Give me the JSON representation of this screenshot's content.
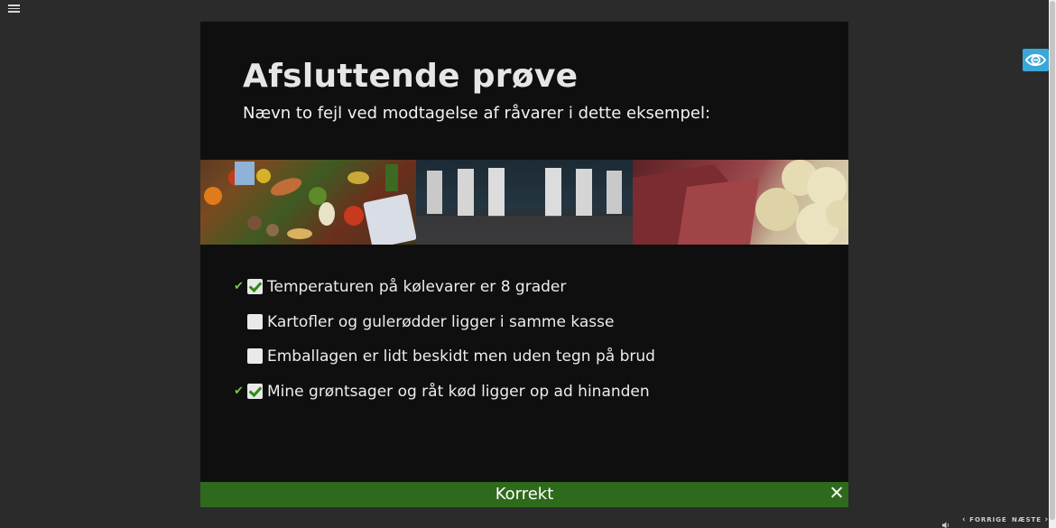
{
  "slide": {
    "title": "Afsluttende prøve",
    "question": "Nævn to fejl ved modtagelse af råvarer i dette eksempel:"
  },
  "options": [
    {
      "label": "Temperaturen på kølevarer er 8 grader",
      "checked": true,
      "correct": true
    },
    {
      "label": "Kartofler og gulerødder ligger i samme kasse",
      "checked": false,
      "correct": false
    },
    {
      "label": "Emballagen er lidt beskidt men uden tegn på brud",
      "checked": false,
      "correct": false
    },
    {
      "label": "Mine grøntsager og råt kød ligger op ad hinanden",
      "checked": true,
      "correct": true
    }
  ],
  "feedback": {
    "text": "Korrekt",
    "color": "#2e6a1c"
  },
  "nav": {
    "prev_label": "FORRIGE",
    "next_label": "NÆSTE"
  },
  "icons": {
    "menu": "hamburger-menu-icon",
    "accessibility": "eye-icon",
    "close": "close-icon",
    "sound": "speaker-icon",
    "correct_mark": "checkmark-icon"
  },
  "colors": {
    "accent": "#3aa7d8",
    "correct_green": "#2e6a1c",
    "check_green": "#7fc24a"
  }
}
